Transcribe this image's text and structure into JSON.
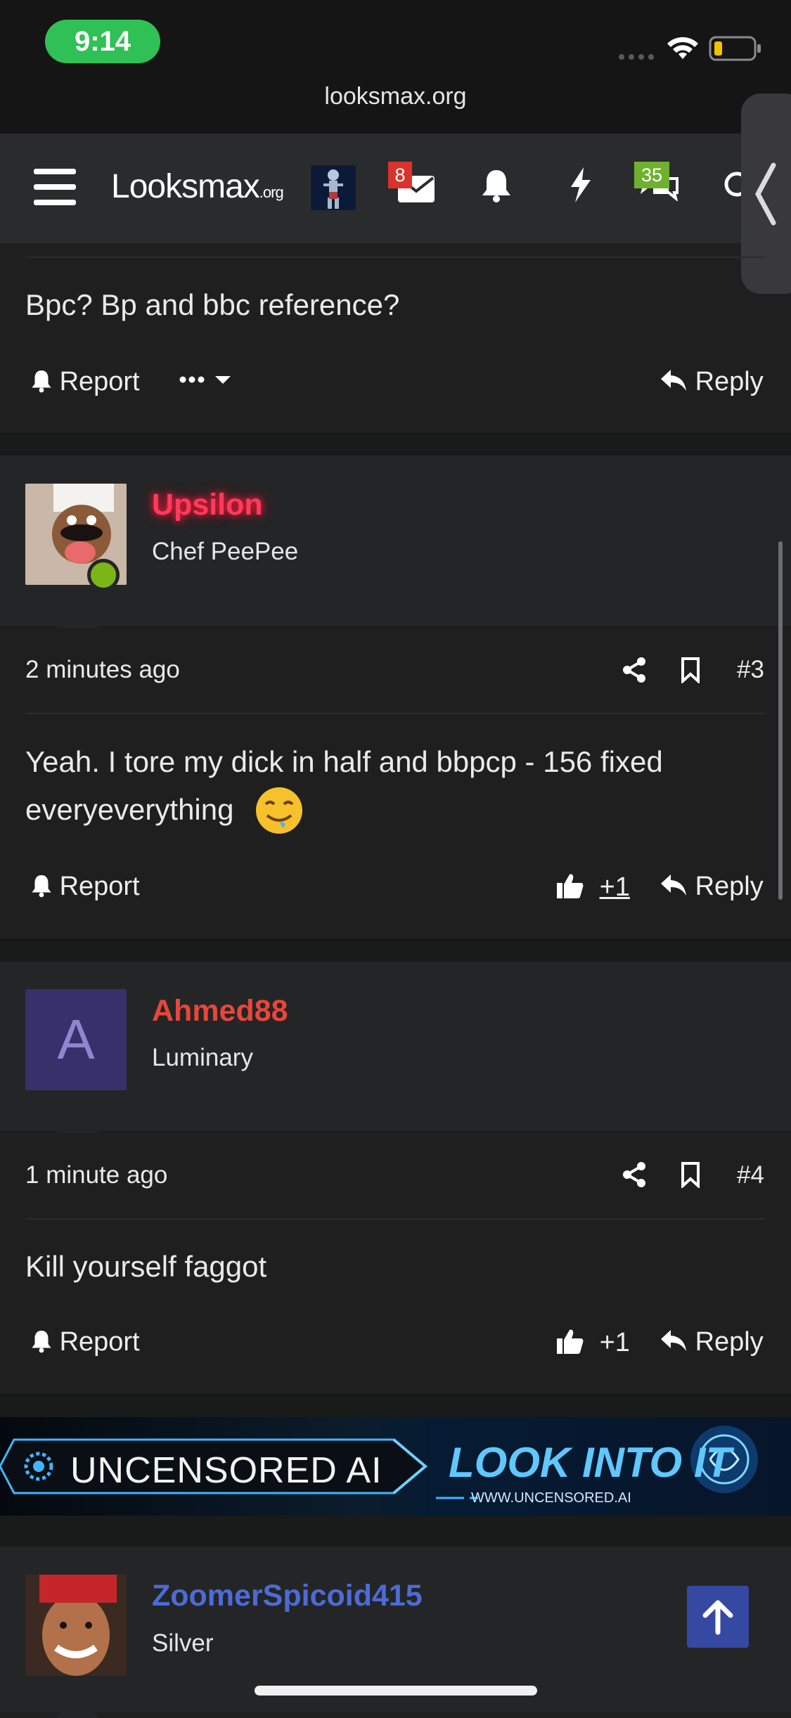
{
  "status_bar": {
    "time": "9:14"
  },
  "browser": {
    "url": "looksmax.org"
  },
  "nav": {
    "logo": "Looksmax",
    "logo_suffix": ".org",
    "inbox_badge": "8",
    "conversations_badge": "35"
  },
  "posts": [
    {
      "body": "Bpc? Bp and bbc reference?",
      "report_label": "Report",
      "reply_label": "Reply"
    },
    {
      "username": "Upsilon",
      "user_title": "Chef PeePee",
      "time": "2 minutes ago",
      "number": "#3",
      "body_line1": "Yeah. I tore my dick in half and bbpcp - 156 fixed",
      "body_line2": "everyeverything",
      "report_label": "Report",
      "likes": "+1",
      "reply_label": "Reply"
    },
    {
      "username": "Ahmed88",
      "user_title": "Luminary",
      "avatar_letter": "A",
      "time": "1 minute ago",
      "number": "#4",
      "body": "Kill yourself faggot",
      "report_label": "Report",
      "likes": "+1",
      "reply_label": "Reply"
    },
    {
      "username": "ZoomerSpicoid415",
      "user_title": "Silver"
    }
  ],
  "ad": {
    "left_text": "UNCENSORED AI",
    "right_text": "LOOK INTO IT",
    "url_text": "WWW.UNCENSORED.AI"
  },
  "colors": {
    "upsilon_name": "#ff3b5c",
    "ahmed_name": "#e8463a",
    "zoomer_name": "#4d6bd6",
    "online_dot": "#7cb518",
    "inbox_badge_bg": "#d9342b",
    "conv_badge_bg": "#6fb12e"
  },
  "icons": [
    "menu-icon",
    "envelope-icon",
    "bell-icon",
    "lightning-icon",
    "chat-icon",
    "search-icon",
    "chevron-left-icon",
    "report-bell-icon",
    "more-icon",
    "caret-down-icon",
    "reply-icon",
    "share-icon",
    "bookmark-icon",
    "thumbs-up-icon",
    "arrow-up-icon",
    "wifi-icon",
    "battery-icon"
  ]
}
